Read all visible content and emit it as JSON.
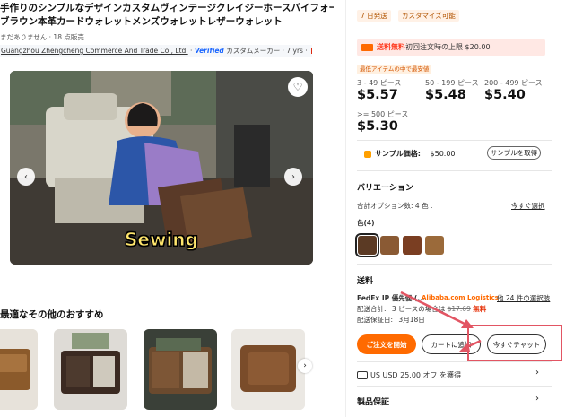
{
  "product": {
    "title_line1": "手作りのシンプルなデザインカスタムヴィンテージクレイジーホースバイフォールドレッド",
    "title_line2": "ブラウン本革カードウォレットメンズウォレットレザーウォレット",
    "meta": "まだありません · 18 点販売",
    "supplier_name": "Guangzhou Zhengcheng Commerce And Trade Co., Ltd.",
    "verified_label": "Verified",
    "supplier_tail": "カスタムメーカー · 7 yrs ·",
    "country": "CN"
  },
  "video": {
    "caption": "Sewing",
    "favorite_icon": "heart-icon",
    "prev_icon": "chevron-left-icon",
    "next_icon": "chevron-right-icon"
  },
  "recommendations": {
    "title": "最適なその他のおすすめ",
    "next_icon": "chevron-right-icon"
  },
  "right_panel": {
    "tags": [
      "7 日発送",
      "カスタマイズ可能"
    ],
    "promo_text_a": "送料無料",
    "promo_text_b": "初回注文時の上限 $20.00",
    "lowest_label": "最低アイテムの中で最安値",
    "tiers": [
      {
        "qty": "3 - 49 ピース",
        "price": "$5.57"
      },
      {
        "qty": "50 - 199 ピース",
        "price": "$5.48"
      },
      {
        "qty": "200 - 499 ピース",
        "price": "$5.40"
      },
      {
        "qty": ">= 500 ピース",
        "price": "$5.30"
      }
    ],
    "sample_label": "サンプル価格:",
    "sample_price": "$50.00",
    "sample_button": "サンプルを取得",
    "variation_title": "バリエーション",
    "variation_summary": "合計オプション数: 4 色 .",
    "variation_link": "今すぐ選択",
    "color_label": "色(4)",
    "swatch_colors": [
      "#5b3a24",
      "#8a5a34",
      "#7a3e22",
      "#9b6a3a"
    ],
    "shipping_title": "送料",
    "carrier": "FedEx IP 優先便 (...",
    "carrier_brand": "Alibaba.com Logistics",
    "shipping_options_link": "他 24 件の選択肢",
    "shipping_total_label": "配送合計:",
    "shipping_total_qty": "3 ピースの場合は",
    "shipping_old_price": "$17.69",
    "shipping_free": "無料",
    "delivery_label": "配送保証日:",
    "delivery_date": "3月18日",
    "btn_order": "ご注文を開始",
    "btn_cart": "カートに追加",
    "btn_chat": "今すぐチャット",
    "coupon_text": "US USD 25.00 オフ を獲得",
    "guarantee_title": "製品保証"
  },
  "colors": {
    "accent_orange": "#ff6a00",
    "annotation_red": "#e25563",
    "price_red": "#e62e04"
  }
}
